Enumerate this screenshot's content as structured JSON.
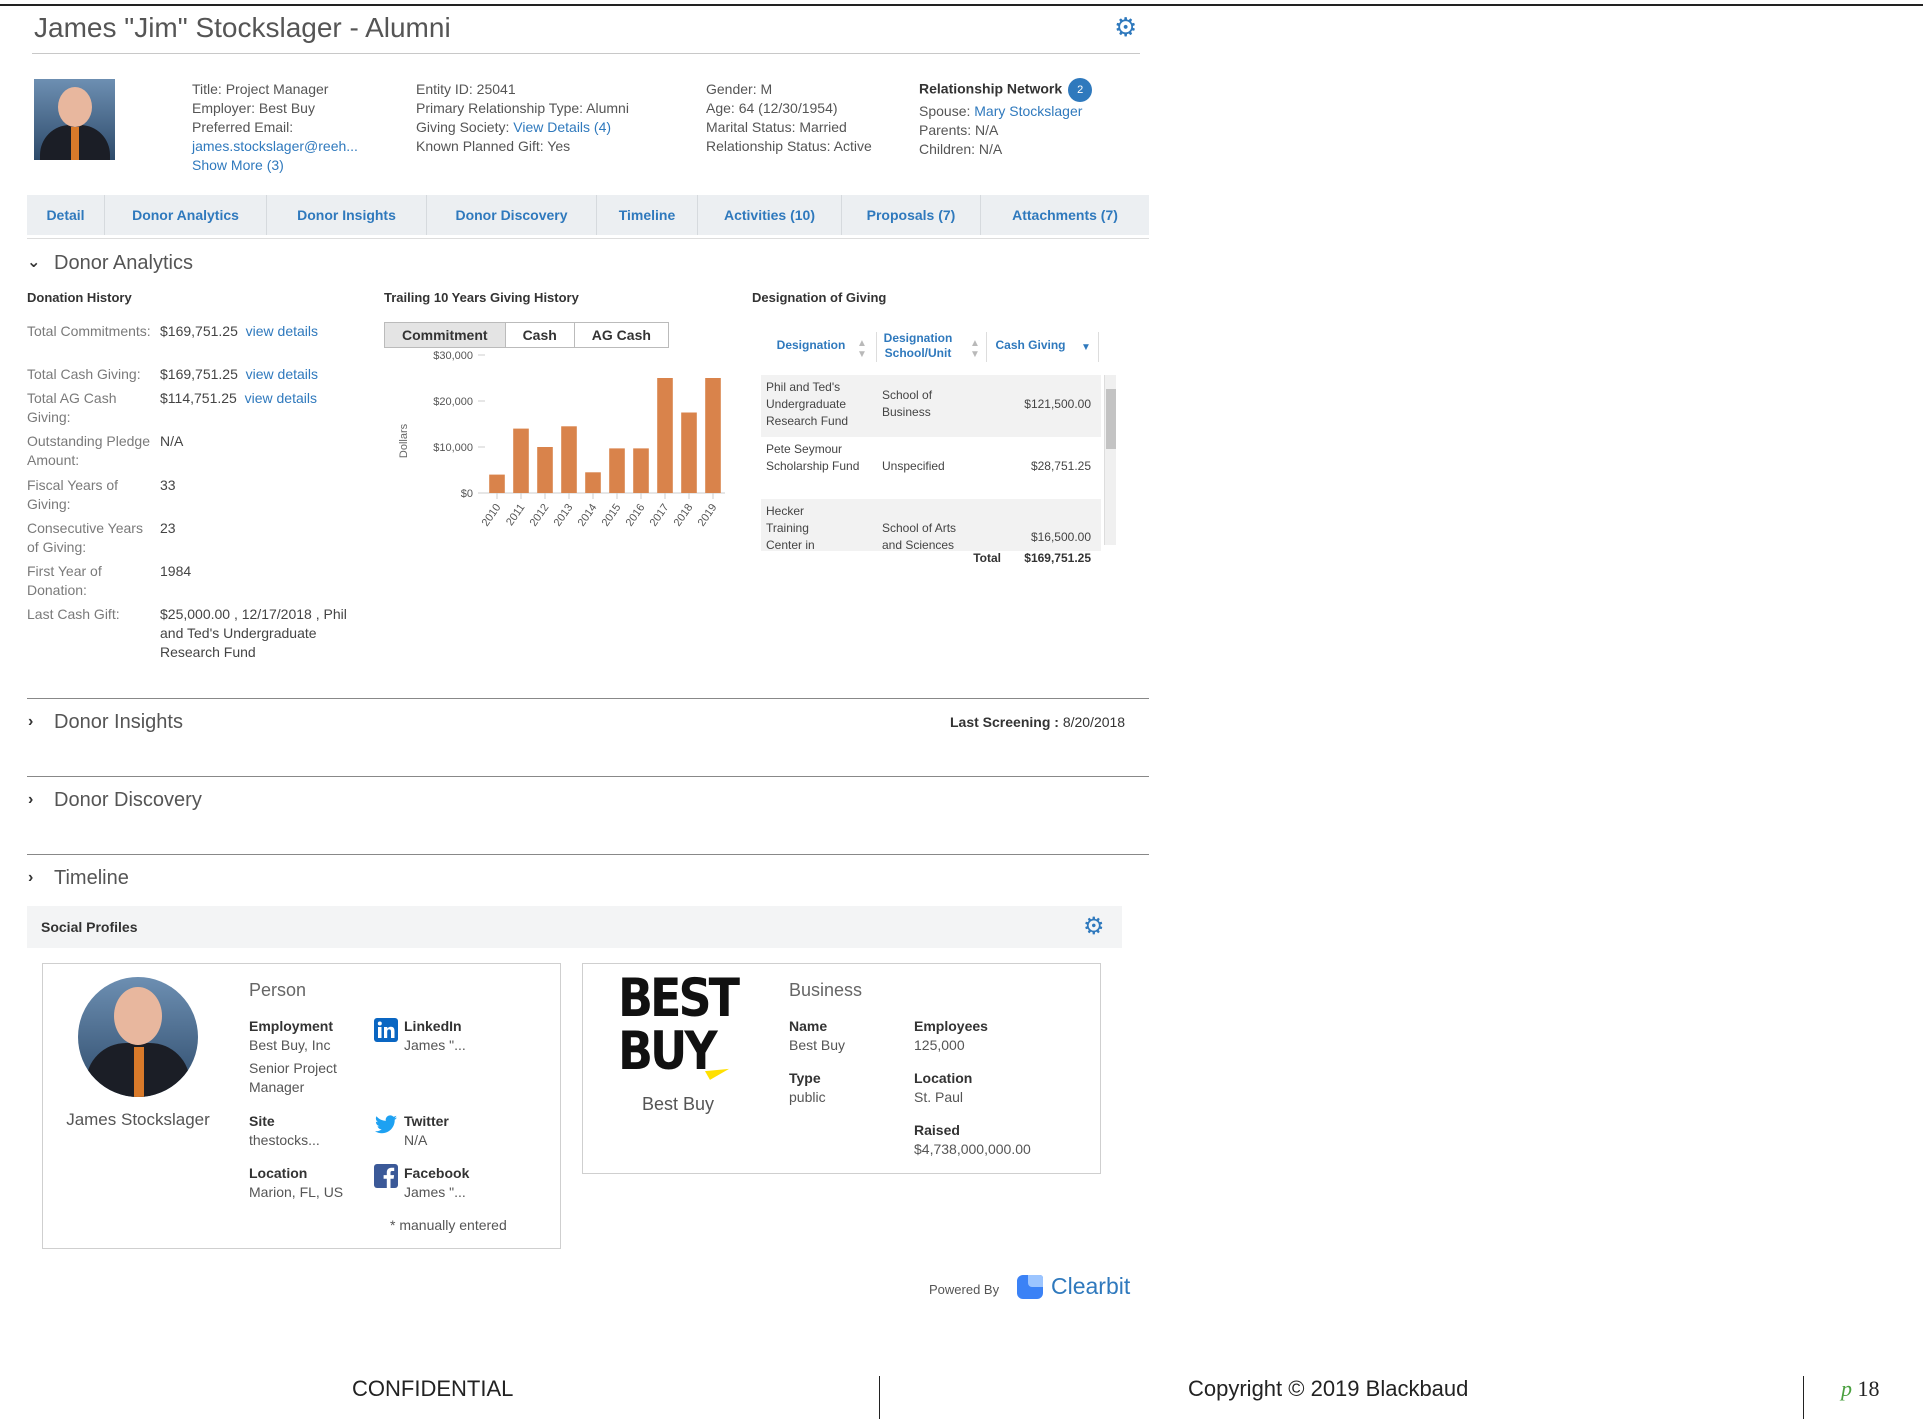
{
  "header": {
    "title": "James \"Jim\" Stockslager - Alumni"
  },
  "profile": {
    "col1": [
      "Title:  Project Manager",
      "Employer:  Best Buy",
      "Preferred Email:"
    ],
    "email": "james.stockslager@reeh...",
    "show_more": "Show More (3)",
    "col2": [
      "Entity ID:  25041",
      "Primary Relationship Type:  Alumni"
    ],
    "giving_society_label": "Giving Society: ",
    "giving_society_link": "View Details (4)",
    "planned_gift": "Known Planned Gift:  Yes",
    "col3": [
      "Gender:  M",
      "Age:  64 (12/30/1954)",
      "Marital Status:  Married",
      "Relationship Status:  Active"
    ],
    "relationship_network": {
      "title": "Relationship Network",
      "count": "2",
      "spouse_label": "Spouse: ",
      "spouse": "Mary Stockslager",
      "parents": "Parents:  N/A",
      "children": "Children:  N/A"
    }
  },
  "tabs": [
    "Detail",
    "Donor Analytics",
    "Donor Insights",
    "Donor Discovery",
    "Timeline",
    "Activities (10)",
    "Proposals (7)",
    "Attachments (7)"
  ],
  "donor_analytics": {
    "title": "Donor Analytics",
    "donation_history_title": "Donation History",
    "rows": [
      {
        "label": "Total Commitments:",
        "value": "$169,751.25",
        "link": "view details"
      },
      {
        "label": "Total Cash Giving:",
        "value": "$169,751.25",
        "link": "view details"
      },
      {
        "label": "Total AG Cash Giving:",
        "value": "$114,751.25",
        "link": "view details"
      },
      {
        "label": "Outstanding Pledge Amount:",
        "value": "N/A",
        "link": ""
      },
      {
        "label": "Fiscal Years of Giving:",
        "value": "33",
        "link": ""
      },
      {
        "label": "Consecutive Years of Giving:",
        "value": "23",
        "link": ""
      },
      {
        "label": "First Year of Donation:",
        "value": "1984",
        "link": ""
      },
      {
        "label": "Last Cash Gift:",
        "value": "$25,000.00 , 12/17/2018 , Phil and Ted's Undergraduate Research Fund",
        "link": ""
      }
    ],
    "trailing_title": "Trailing 10 Years Giving History",
    "segments": [
      "Commitment",
      "Cash",
      "AG Cash"
    ],
    "designation_title": "Designation of Giving",
    "designation": {
      "headers": [
        "Designation",
        "Designation School/Unit",
        "Cash Giving"
      ],
      "rows": [
        {
          "designation": "Phil and Ted's Undergraduate Research Fund",
          "unit": "School of Business",
          "amount": "$121,500.00"
        },
        {
          "designation": "Pete Seymour Scholarship Fund",
          "unit": "Unspecified",
          "amount": "$28,751.25"
        },
        {
          "designation": "Hecker Training Center in",
          "unit": "School of Arts and Sciences",
          "amount": "$16,500.00"
        }
      ],
      "total_label": "Total",
      "total": "$169,751.25"
    }
  },
  "chart_data": {
    "type": "bar",
    "title": "Trailing 10 Years Giving History",
    "categories": [
      "2010",
      "2011",
      "2012",
      "2013",
      "2014",
      "2015",
      "2016",
      "2017",
      "2018",
      "2019"
    ],
    "values": [
      4000,
      14000,
      10000,
      14500,
      4500,
      9700,
      9700,
      25000,
      17500,
      25000
    ],
    "ylabel": "Dollars",
    "ylim": [
      0,
      30000
    ],
    "yticks": [
      "$0",
      "$10,000",
      "$20,000",
      "$30,000"
    ],
    "bar_color": "#d9834b"
  },
  "donor_insights": {
    "title": "Donor Insights",
    "screening_label": "Last Screening : ",
    "screening_date": "8/20/2018"
  },
  "donor_discovery": {
    "title": "Donor Discovery"
  },
  "timeline": {
    "title": "Timeline"
  },
  "social": {
    "title": "Social Profiles",
    "person": {
      "heading": "Person",
      "name": "James Stockslager",
      "employment_label": "Employment",
      "employment": "Best Buy, Inc",
      "role": "Senior Project Manager",
      "site_label": "Site",
      "site": "thestocks...",
      "location_label": "Location",
      "location": "Marion, FL, US",
      "linkedin_label": "LinkedIn",
      "linkedin": "James \"...",
      "twitter_label": "Twitter",
      "twitter": "N/A",
      "facebook_label": "Facebook",
      "facebook": "James \"...",
      "note": "* manually entered"
    },
    "business": {
      "heading": "Business",
      "logo_line1": "BEST",
      "logo_line2": "BUY",
      "name_caption": "Best Buy",
      "name_label": "Name",
      "name": "Best Buy",
      "type_label": "Type",
      "type": "public",
      "employees_label": "Employees",
      "employees": "125,000",
      "location_label": "Location",
      "location": "St. Paul",
      "raised_label": "Raised",
      "raised": "$4,738,000,000.00"
    },
    "powered_by": "Powered By",
    "clearbit": "Clearbit"
  },
  "footer": {
    "confidential": "CONFIDENTIAL",
    "copyright": "Copyright © 2019 Blackbaud",
    "page_prefix": "p",
    "page": "18"
  },
  "colors": {
    "link": "#2f79bd",
    "bar": "#d9834b",
    "tab_bg": "#eceff2"
  },
  "icons": [
    "gear-icon",
    "chevron-down-icon",
    "chevron-right-icon",
    "linkedin-icon",
    "twitter-icon",
    "facebook-icon",
    "clearbit-icon",
    "sort-icon"
  ]
}
